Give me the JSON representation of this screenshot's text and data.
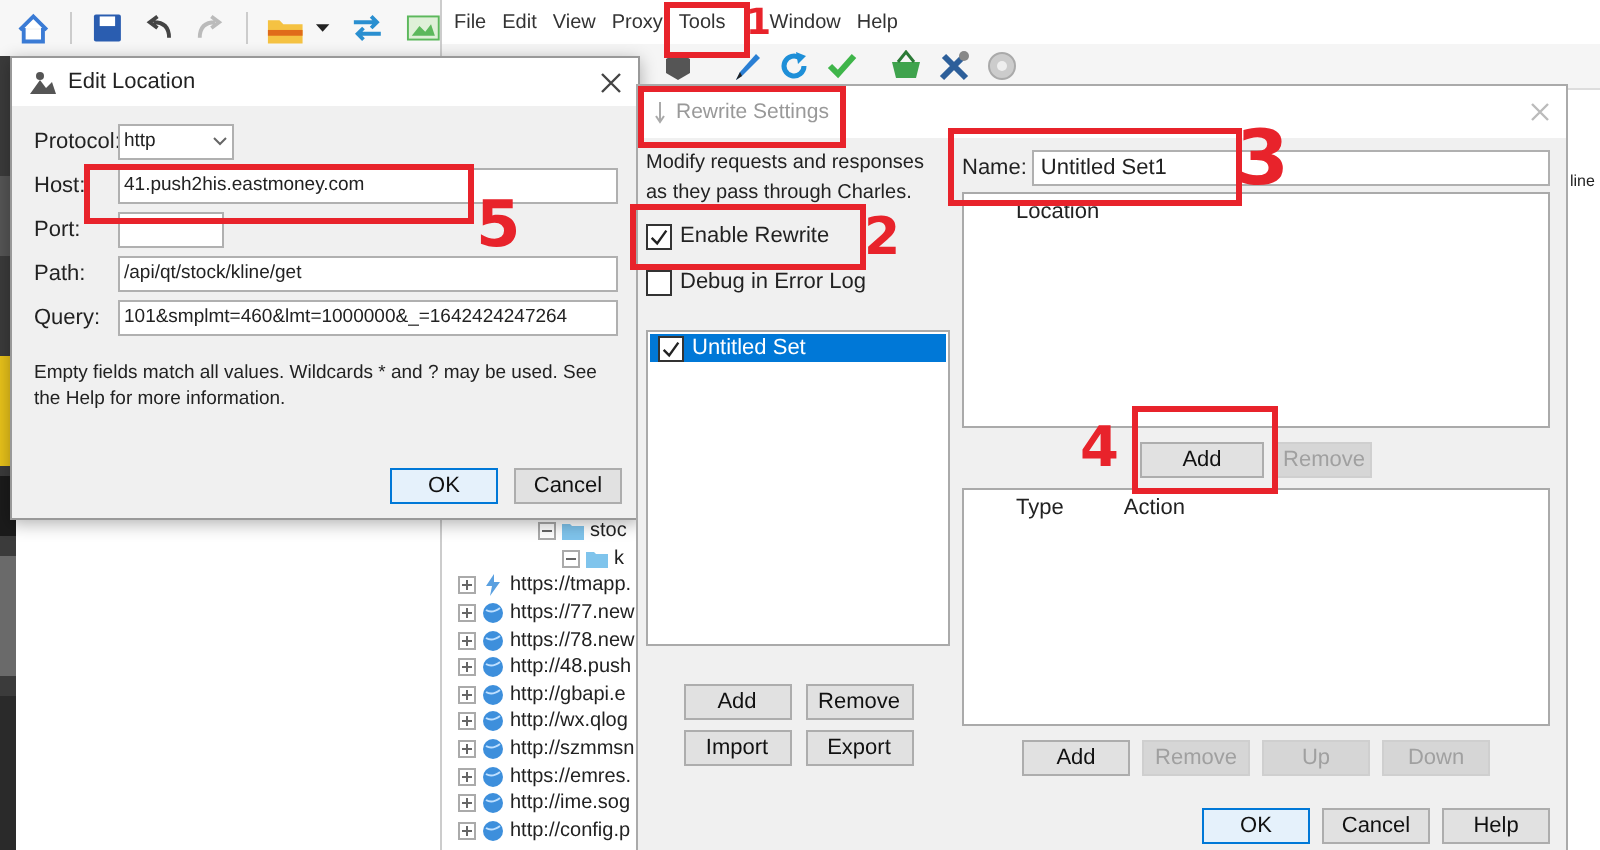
{
  "main_window": {
    "menu": [
      "File",
      "Edit",
      "View",
      "Proxy",
      "Tools",
      "Window",
      "Help"
    ],
    "tree": [
      {
        "label": "stoc",
        "kind": "folder",
        "expanded": true,
        "children": [
          {
            "label": "k",
            "kind": "folder",
            "expanded": true
          }
        ]
      },
      {
        "label": "https://tmapp.",
        "kind": "lightning",
        "expanded": false
      },
      {
        "label": "https://77.new",
        "kind": "globe",
        "expanded": false
      },
      {
        "label": "https://78.new",
        "kind": "globe",
        "expanded": false
      },
      {
        "label": "http://48.push",
        "kind": "globe",
        "expanded": false
      },
      {
        "label": "http://gbapi.e",
        "kind": "globe",
        "expanded": false
      },
      {
        "label": "http://wx.qlog",
        "kind": "globe",
        "expanded": false
      },
      {
        "label": "http://szmmsn",
        "kind": "globe",
        "expanded": false
      },
      {
        "label": "https://emres.",
        "kind": "globe",
        "expanded": false
      },
      {
        "label": "http://ime.sog",
        "kind": "globe",
        "expanded": false
      },
      {
        "label": "http://config.p",
        "kind": "globe",
        "expanded": false
      }
    ],
    "side_text": "line"
  },
  "edit_location": {
    "title": "Edit Location",
    "fields": [
      {
        "label": "Protocol:",
        "kind": "select",
        "value": "http"
      },
      {
        "label": "Host:",
        "kind": "text",
        "value": "41.push2his.eastmoney.com"
      },
      {
        "label": "Port:",
        "kind": "short"
      },
      {
        "label": "Path:",
        "kind": "text",
        "value": "/api/qt/stock/kline/get"
      },
      {
        "label": "Query:",
        "kind": "text",
        "value": "101&smplmt=460&lmt=1000000&_=1642424247264"
      }
    ],
    "note": "Empty fields match all values. Wildcards * and ? may be used. See the Help for more information.",
    "buttons": [
      {
        "label": "OK",
        "default": true
      },
      {
        "label": "Cancel",
        "default": false
      }
    ]
  },
  "rewrite_settings": {
    "title": "Rewrite Settings",
    "description": "Modify requests and responses as they pass through Charles.",
    "options": [
      {
        "label": "Enable Rewrite",
        "checked": true
      },
      {
        "label": "Debug in Error Log",
        "checked": false
      }
    ],
    "sets": [
      {
        "label": "Untitled Set",
        "checked": true,
        "selected": true
      }
    ],
    "set_buttons": [
      "Add",
      "Remove",
      "Import",
      "Export"
    ],
    "name_label": "Name:",
    "name_value": "Untitled Set1",
    "location_columns": [
      "Location"
    ],
    "location_buttons": [
      {
        "label": "Add",
        "disabled": false
      },
      {
        "label": "Remove",
        "disabled": true
      }
    ],
    "rule_columns": [
      "Type",
      "Action"
    ],
    "rule_buttons": [
      {
        "label": "Add",
        "disabled": false
      },
      {
        "label": "Remove",
        "disabled": true
      },
      {
        "label": "Up",
        "disabled": true
      },
      {
        "label": "Down",
        "disabled": true
      }
    ],
    "buttons": [
      {
        "label": "OK",
        "default": true
      },
      {
        "label": "Cancel",
        "default": false
      },
      {
        "label": "Help",
        "default": false
      }
    ]
  },
  "annotations": [
    {
      "label": "1"
    },
    {
      "label": "2"
    },
    {
      "label": "3"
    },
    {
      "label": "4"
    },
    {
      "label": "5"
    }
  ]
}
